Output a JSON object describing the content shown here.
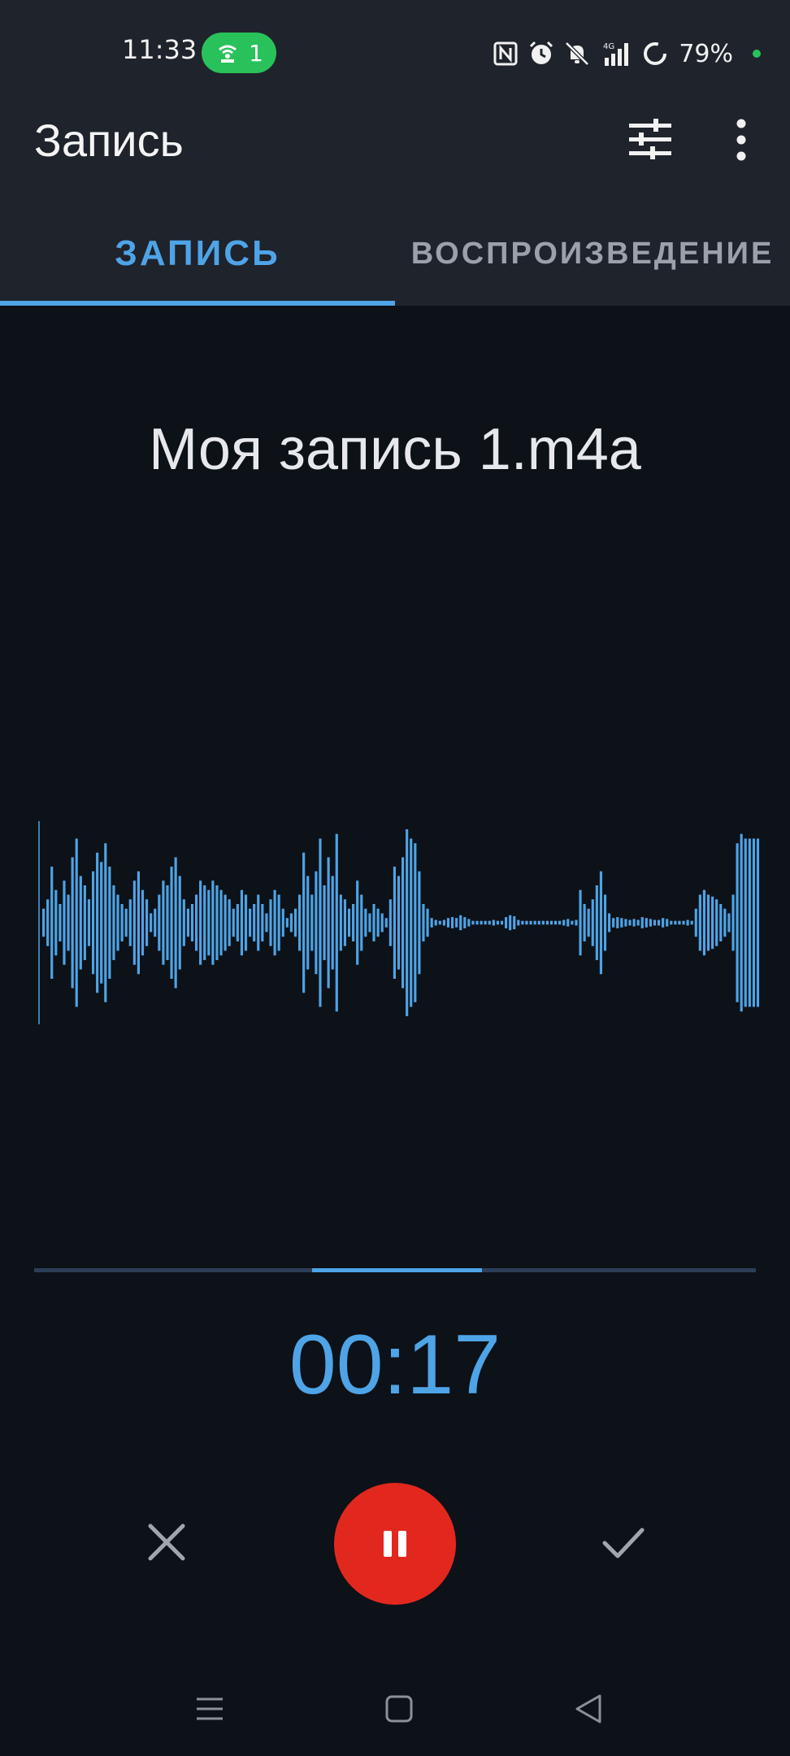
{
  "status_bar": {
    "time": "11:33",
    "hotspot_count": "1",
    "battery": "79%",
    "signal_label": "4G",
    "icons": [
      "nfc-icon",
      "alarm-icon",
      "mute-icon",
      "signal-icon",
      "battery-icon"
    ],
    "colors": {
      "hotspot": "#29c25a",
      "charge_dot": "#29c25a"
    }
  },
  "app_bar": {
    "title": "Запись",
    "actions": [
      "tune-icon",
      "more-vert-icon"
    ]
  },
  "tabs": [
    {
      "label": "ЗАПИСЬ",
      "active": true
    },
    {
      "label": "ВОСПРОИЗВЕДЕНИЕ",
      "active": false
    }
  ],
  "recording": {
    "file_name": "Моя запись 1.m4a",
    "timer": "00:17",
    "progress_window": {
      "start_fraction": 0.385,
      "end_fraction": 0.62
    }
  },
  "controls": {
    "cancel": "close-icon",
    "pause": "pause-icon",
    "confirm": "check-icon"
  },
  "nav_bar": [
    "menu-icon",
    "home-icon",
    "back-icon"
  ],
  "colors": {
    "accent": "#4ea4e6",
    "record_button": "#e2281e",
    "background": "#0d1118",
    "toolbar": "#1f232c"
  },
  "waveform_levels": [
    0.15,
    0.25,
    0.6,
    0.35,
    0.2,
    0.45,
    0.3,
    0.7,
    0.9,
    0.5,
    0.4,
    0.25,
    0.55,
    0.75,
    0.65,
    0.85,
    0.6,
    0.4,
    0.3,
    0.2,
    0.15,
    0.25,
    0.45,
    0.55,
    0.35,
    0.25,
    0.1,
    0.15,
    0.3,
    0.45,
    0.4,
    0.6,
    0.7,
    0.5,
    0.25,
    0.15,
    0.2,
    0.3,
    0.45,
    0.4,
    0.35,
    0.45,
    0.4,
    0.35,
    0.3,
    0.25,
    0.15,
    0.2,
    0.35,
    0.3,
    0.15,
    0.2,
    0.3,
    0.2,
    0.1,
    0.25,
    0.35,
    0.3,
    0.15,
    0.05,
    0.1,
    0.15,
    0.3,
    0.75,
    0.5,
    0.3,
    0.55,
    0.9,
    0.4,
    0.7,
    0.5,
    0.95,
    0.3,
    0.25,
    0.15,
    0.2,
    0.45,
    0.3,
    0.15,
    0.1,
    0.2,
    0.15,
    0.1,
    0.05,
    0.25,
    0.6,
    0.5,
    0.7,
    1.0,
    0.9,
    0.85,
    0.55,
    0.2,
    0.15,
    0.05,
    0.03,
    0.02,
    0.03,
    0.05,
    0.06,
    0.05,
    0.08,
    0.06,
    0.04,
    0.02,
    0.02,
    0.02,
    0.02,
    0.02,
    0.03,
    0.02,
    0.02,
    0.06,
    0.08,
    0.07,
    0.03,
    0.02,
    0.02,
    0.02,
    0.02,
    0.02,
    0.02,
    0.02,
    0.02,
    0.02,
    0.02,
    0.03,
    0.04,
    0.02,
    0.03,
    0.35,
    0.2,
    0.15,
    0.25,
    0.4,
    0.55,
    0.3,
    0.1,
    0.05,
    0.06,
    0.05,
    0.04,
    0.03,
    0.04,
    0.03,
    0.06,
    0.05,
    0.04,
    0.03,
    0.03,
    0.05,
    0.04,
    0.02,
    0.02,
    0.02,
    0.02,
    0.03,
    0.02,
    0.15,
    0.3,
    0.35,
    0.3,
    0.28,
    0.25,
    0.2,
    0.15,
    0.1,
    0.3,
    0.85,
    0.95,
    0.9,
    0.9,
    0.9,
    0.9
  ]
}
